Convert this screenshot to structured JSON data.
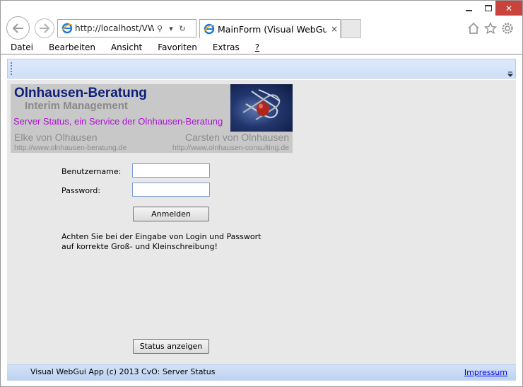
{
  "browser": {
    "address": "http://localhost/VWGI",
    "tab_title": "MainForm (Visual WebGui -...",
    "tab_close": "×",
    "search_glyph": "⚲",
    "dropdown_glyph": "▾",
    "refresh_glyph": "↻"
  },
  "window_controls": {
    "close": "✕"
  },
  "menu": [
    "Datei",
    "Bearbeiten",
    "Ansicht",
    "Favoriten",
    "Extras",
    "?"
  ],
  "banner": {
    "title": "Olnhausen-Beratung",
    "subtitle": "Interim Management",
    "service": "Server Status, ein Service der Olnhausen-Beratung",
    "left_name": "Elke von Olhausen",
    "left_url": "http://www.olnhausen-beratung.de",
    "right_name": "Carsten von Olnhausen",
    "right_url": "http://www.olnhausen-consulting.de"
  },
  "login": {
    "username_label": "Benutzername:",
    "username_value": "",
    "password_label": "Password:",
    "password_value": "",
    "login_button": "Anmelden",
    "hint_line1": "Achten Sie bei der Eingabe von Login und Passwort",
    "hint_line2": "auf korrekte Groß- und Kleinschreibung!",
    "status_button": "Status anzeigen"
  },
  "statusbar": {
    "text": "Visual WebGui App (c) 2013 CvO: Server Status",
    "link": "Impressum"
  },
  "colors": {
    "banner_title": "#0d1f7a",
    "banner_service": "#b012d8",
    "toolbar_blue": "#dde9fa",
    "statusbar_blue": "#bcd2ef"
  }
}
